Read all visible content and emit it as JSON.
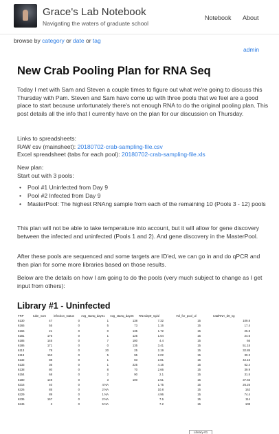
{
  "site": {
    "title": "Grace's Lab Notebook",
    "description": "Navigating the waters of graduate school",
    "nav": [
      "Notebook",
      "About"
    ]
  },
  "browse": {
    "prefix": "browse by",
    "category": "category",
    "or1": "or",
    "date": "date",
    "or2": "or",
    "tag": "tag",
    "admin": "admin"
  },
  "post": {
    "title": "New Crab Pooling Plan for RNA Seq",
    "intro": "Today I met with Sam and Steven a couple times to figure out what we're going to discuss this Thursday with Pam. Steven and Sam have come up with three pools that we feel are a good place to start because unfortunately there's not enough RNA to do the original pooling plan. This post details all the info that I currently have on the plan for our discussion on Thursday.",
    "links_heading": "Links to spreadsheets:",
    "raw_label": "RAW csv (mainsheet):",
    "raw_link": "20180702-crab-sampling-file.csv",
    "excel_label": "Excel spreadsheet (tabs for each pool):",
    "excel_link": "20180702-crab-sampling-file.xls",
    "plan_heading": "New plan:",
    "plan_sub": "Start out with 3 pools:",
    "pools": [
      "Pool #1 Uninfected from Day 9",
      "Pool #2 Infected from Day 9",
      "MasterPool: The highest RNAng sample from each of the remaining 10 (Pools 3 - 12) pools"
    ],
    "para_gene": "This plan will not be able to take temperature into account, but it will allow for gene discovery between the infected and uninfected (Pools 1 and 2). And gene discovery in the MasterPool.",
    "para_after": "After these pools are sequenced and some targets are ID'ed, we can go in and do qPCR and then plan for some more libraries based on those results.",
    "para_below": "Below are the details on how I am going to do the pools (very much subject to change as I get input from others):",
    "library_title": "Library #1 - Uninfected"
  },
  "sheet": {
    "headers": [
      "FRP",
      "tube_num",
      "infection_status",
      "Avg_startq_day01",
      "Avg_startq_day26",
      "RNAday9_ng/ul",
      "",
      "Vol_for_pool_ul",
      "",
      "totalRNA_d9_ng"
    ],
    "rows": [
      [
        "6130",
        "47",
        "0",
        "1",
        "138",
        "7.32",
        "",
        "15",
        "",
        "109.8"
      ],
      [
        "6165",
        "55",
        "0",
        "5",
        "73",
        "1.16",
        "",
        "15",
        "",
        "17.4"
      ],
      [
        "6166",
        "21",
        "0",
        "0",
        "135",
        "1.72",
        "",
        "15",
        "",
        "25.8"
      ],
      [
        "6181",
        "175",
        "0",
        "1",
        "125",
        "1.64",
        "",
        "15",
        "",
        "24.6"
      ],
      [
        "6185",
        "145",
        "0",
        "7",
        "180",
        "4.4",
        "",
        "15",
        "",
        "66"
      ],
      [
        "6186",
        "171",
        "0",
        "0",
        "135",
        "3.41",
        "",
        "15",
        "",
        "51.15"
      ],
      [
        "6113",
        "78",
        "0",
        "20",
        "25",
        "2.19",
        "",
        "15",
        "",
        "32.85"
      ],
      [
        "6119",
        "153",
        "0",
        "5",
        "95",
        "2.02",
        "",
        "15",
        "",
        "30.3"
      ],
      [
        "6132",
        "88",
        "0",
        "1",
        "83",
        "2.81",
        "",
        "15",
        "",
        "42.15"
      ],
      [
        "6133",
        "36",
        "0",
        "1",
        "225",
        "4.16",
        "",
        "15",
        "",
        "62.4"
      ],
      [
        "6138",
        "80",
        "0",
        "8",
        "70",
        "2.66",
        "",
        "15",
        "",
        "39.9"
      ],
      [
        "6154",
        "68",
        "0",
        "2",
        "90",
        "2.1",
        "",
        "15",
        "",
        "31.5"
      ],
      [
        "6180",
        "149",
        "0",
        "3",
        "100",
        "2.51",
        "",
        "15",
        "",
        "37.65"
      ],
      [
        "6216",
        "40",
        "0",
        "4 NA",
        "",
        "1.75",
        "",
        "15",
        "",
        "26.25"
      ],
      [
        "6226",
        "85",
        "0",
        "2 NA",
        "",
        "10.8",
        "",
        "15",
        "",
        "162"
      ],
      [
        "6229",
        "89",
        "0",
        "1 NA",
        "",
        "4.96",
        "",
        "15",
        "",
        "74.4"
      ],
      [
        "6236",
        "157",
        "0",
        "2 NA",
        "",
        "7.6",
        "",
        "15",
        "",
        "114"
      ],
      [
        "6246",
        "3",
        "0",
        "5 NA",
        "",
        "7.2",
        "",
        "15",
        "",
        "108"
      ]
    ],
    "tab": "Library-01"
  }
}
